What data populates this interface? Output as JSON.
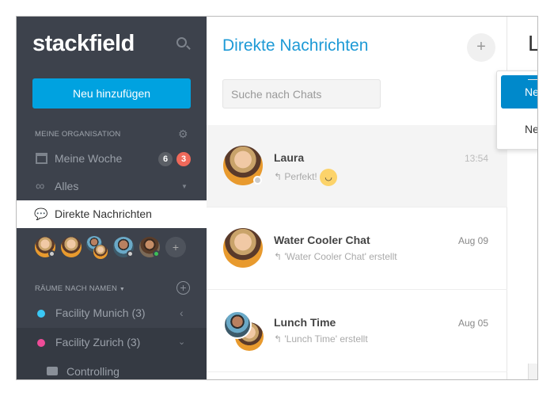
{
  "sidebar": {
    "logo": "stackfield",
    "new_button": "Neu hinzufügen",
    "org_section": "MEINE ORGANISATION",
    "items": [
      {
        "label": "Meine Woche",
        "badges": [
          "6",
          "3"
        ]
      },
      {
        "label": "Alles"
      },
      {
        "label": "Direkte Nachrichten"
      }
    ],
    "rooms_section": "RÄUME NACH NAMEN",
    "rooms": [
      {
        "label": "Facility Munich (3)",
        "color": "#3ac8f5"
      },
      {
        "label": "Facility Zurich (3)",
        "color": "#ee4c98"
      }
    ],
    "subroom": "Controlling"
  },
  "main": {
    "title": "Direkte Nachrichten",
    "search_placeholder": "Suche nach Chats",
    "chats": [
      {
        "name": "Laura",
        "preview": "Perfekt!",
        "time": "13:54"
      },
      {
        "name": "Water Cooler Chat",
        "preview": "'Water Cooler Chat' erstellt",
        "time": "Aug 09"
      },
      {
        "name": "Lunch Time",
        "preview": "'Lunch Time' erstellt",
        "time": "Aug 05"
      }
    ]
  },
  "menu": {
    "items": [
      "Neuer Gruppenchat",
      "Neues Mitglied einladen"
    ]
  },
  "right": {
    "heading": "L"
  },
  "colors": {
    "accent": "#00a2e0",
    "menu_active": "#0089cb",
    "sidebar": "#3d424c",
    "badge_red": "#f0695a"
  }
}
